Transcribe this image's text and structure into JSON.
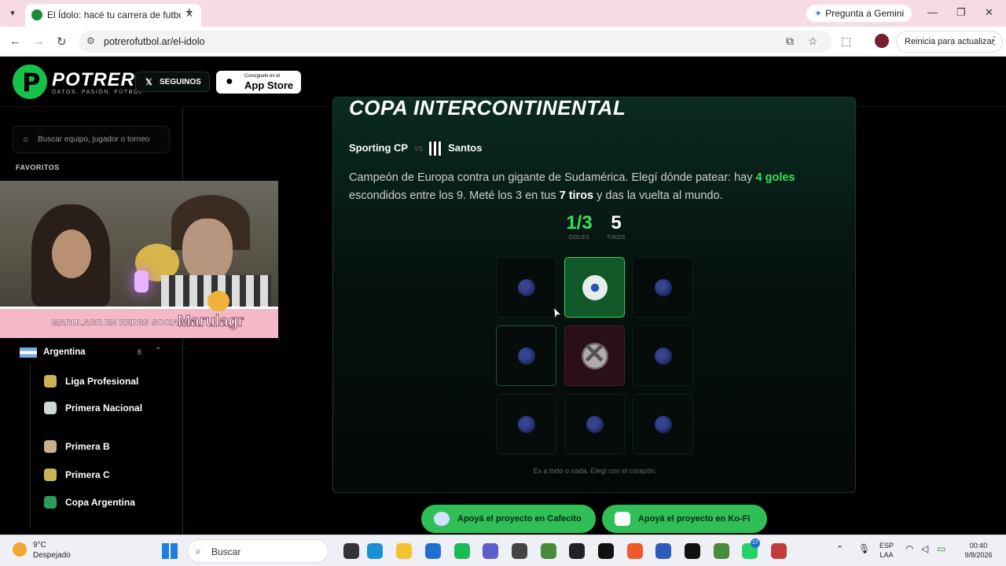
{
  "browser": {
    "tab_title": "El Ídolo: hacé tu carrera de futbol",
    "url": "potrerofutbol.ar/el-idolo",
    "gemini_label": "Pregunta a Gemini",
    "relaunch_label": "Reinicia para actualizar"
  },
  "site": {
    "logo_name": "POTRERO",
    "logo_tagline": "DATOS. PASIÓN. FÚTBOL.",
    "follow_label": "SEGUINOS",
    "appstore_small": "Consíguelo en el",
    "appstore_big": "App Store"
  },
  "sidebar": {
    "search_placeholder": "Buscar equipo, jugador o torneo",
    "favorites_title": "FAVORITOS",
    "country": {
      "name": "Argentina",
      "count": "8"
    },
    "leagues": [
      {
        "name": "Liga Profesional",
        "color": "#c9b458"
      },
      {
        "name": "Primera Nacional",
        "color": "#cfd8d8"
      },
      {
        "name": "Primera B",
        "color": "#c9b08a"
      },
      {
        "name": "Primera C",
        "color": "#c9b458"
      },
      {
        "name": "Copa Argentina",
        "color": "#2a9d5a"
      }
    ]
  },
  "webcam": {
    "banner_text": "MARULAGR EN REDES SOCIALES",
    "banner_logo": "Marulagr"
  },
  "game": {
    "cup_title": "COPA INTERCONTINENTAL",
    "team_home": "Sporting CP",
    "vs": "vs",
    "team_away": "Santos",
    "desc_part1": "Campeón de Europa contra un gigante de Sudamérica. Elegí dónde patear: hay ",
    "desc_goals": "4 goles",
    "desc_part2": " escondidos entre los 9. Meté los 3 en tus ",
    "desc_shots": "7 tiros",
    "desc_part3": " y das la vuelta al mundo.",
    "goals_value": "1/3",
    "goals_label": "GOLES",
    "shots_value": "5",
    "shots_label": "TIROS",
    "cells": [
      "hidden",
      "goal",
      "hidden",
      "visited",
      "miss",
      "hidden",
      "hidden",
      "hidden",
      "hidden"
    ],
    "footnote": "Es a todo o nada. Elegí con el corazón."
  },
  "support": {
    "cafecito": "Apoyá el proyecto en Cafecito",
    "kofi": "Apoyá el proyecto en Ko-Fi"
  },
  "taskbar": {
    "temp": "9°C",
    "weather": "Despejado",
    "search": "Buscar",
    "lang1": "ESP",
    "lang2": "LAA",
    "time": "00:40",
    "date": "9/8/2026",
    "badge": "17"
  },
  "colors": {
    "accent": "#35e25a",
    "brand": "#16c24a"
  }
}
